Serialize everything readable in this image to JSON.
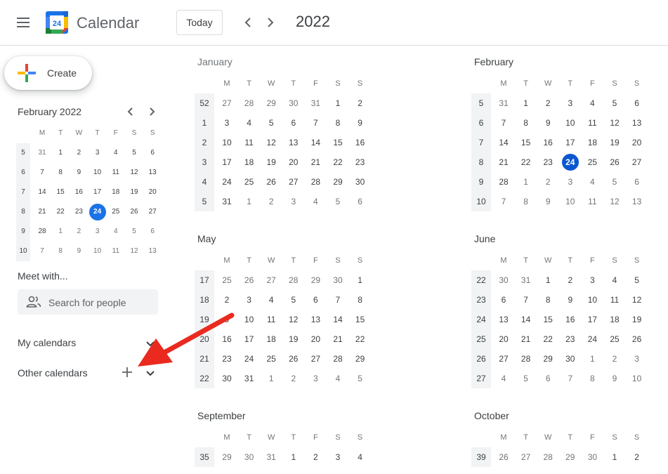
{
  "header": {
    "app_title": "Calendar",
    "logo_number": "24",
    "today_label": "Today",
    "year": "2022"
  },
  "create_label": "Create",
  "mini": {
    "title": "February 2022",
    "day_headers": [
      "M",
      "T",
      "W",
      "T",
      "F",
      "S",
      "S"
    ],
    "rows": [
      {
        "wk": "5",
        "days": [
          "31",
          "1",
          "2",
          "3",
          "4",
          "5",
          "6"
        ],
        "other": [
          0
        ]
      },
      {
        "wk": "6",
        "days": [
          "7",
          "8",
          "9",
          "10",
          "11",
          "12",
          "13"
        ],
        "other": []
      },
      {
        "wk": "7",
        "days": [
          "14",
          "15",
          "16",
          "17",
          "18",
          "19",
          "20"
        ],
        "other": []
      },
      {
        "wk": "8",
        "days": [
          "21",
          "22",
          "23",
          "24",
          "25",
          "26",
          "27"
        ],
        "other": []
      },
      {
        "wk": "9",
        "days": [
          "28",
          "1",
          "2",
          "3",
          "4",
          "5",
          "6"
        ],
        "other": [
          1,
          2,
          3,
          4,
          5,
          6
        ]
      },
      {
        "wk": "10",
        "days": [
          "7",
          "8",
          "9",
          "10",
          "11",
          "12",
          "13"
        ],
        "other": [
          0,
          1,
          2,
          3,
          4,
          5,
          6
        ]
      }
    ],
    "today": {
      "row": 3,
      "col": 3
    }
  },
  "meet": {
    "title": "Meet with...",
    "search_placeholder": "Search for people"
  },
  "sections": {
    "my_calendars": "My calendars",
    "other_calendars": "Other calendars"
  },
  "day_headers": [
    "M",
    "T",
    "W",
    "T",
    "F",
    "S",
    "S"
  ],
  "months": [
    {
      "name": "January",
      "past": true,
      "rows": [
        {
          "wk": "52",
          "days": [
            "27",
            "28",
            "29",
            "30",
            "31",
            "1",
            "2"
          ],
          "other": [
            0,
            1,
            2,
            3,
            4
          ]
        },
        {
          "wk": "1",
          "days": [
            "3",
            "4",
            "5",
            "6",
            "7",
            "8",
            "9"
          ],
          "other": []
        },
        {
          "wk": "2",
          "days": [
            "10",
            "11",
            "12",
            "13",
            "14",
            "15",
            "16"
          ],
          "other": []
        },
        {
          "wk": "3",
          "days": [
            "17",
            "18",
            "19",
            "20",
            "21",
            "22",
            "23"
          ],
          "other": []
        },
        {
          "wk": "4",
          "days": [
            "24",
            "25",
            "26",
            "27",
            "28",
            "29",
            "30"
          ],
          "other": []
        },
        {
          "wk": "5",
          "days": [
            "31",
            "1",
            "2",
            "3",
            "4",
            "5",
            "6"
          ],
          "other": [
            1,
            2,
            3,
            4,
            5,
            6
          ]
        }
      ]
    },
    {
      "name": "February",
      "past": false,
      "rows": [
        {
          "wk": "5",
          "days": [
            "31",
            "1",
            "2",
            "3",
            "4",
            "5",
            "6"
          ],
          "other": [
            0
          ]
        },
        {
          "wk": "6",
          "days": [
            "7",
            "8",
            "9",
            "10",
            "11",
            "12",
            "13"
          ],
          "other": []
        },
        {
          "wk": "7",
          "days": [
            "14",
            "15",
            "16",
            "17",
            "18",
            "19",
            "20"
          ],
          "other": []
        },
        {
          "wk": "8",
          "days": [
            "21",
            "22",
            "23",
            "24",
            "25",
            "26",
            "27"
          ],
          "other": []
        },
        {
          "wk": "9",
          "days": [
            "28",
            "1",
            "2",
            "3",
            "4",
            "5",
            "6"
          ],
          "other": [
            1,
            2,
            3,
            4,
            5,
            6
          ]
        },
        {
          "wk": "10",
          "days": [
            "7",
            "8",
            "9",
            "10",
            "11",
            "12",
            "13"
          ],
          "other": [
            0,
            1,
            2,
            3,
            4,
            5,
            6
          ]
        }
      ],
      "today": {
        "row": 3,
        "col": 3
      }
    },
    {
      "name": "May",
      "past": false,
      "rows": [
        {
          "wk": "17",
          "days": [
            "25",
            "26",
            "27",
            "28",
            "29",
            "30",
            "1"
          ],
          "other": [
            0,
            1,
            2,
            3,
            4,
            5
          ]
        },
        {
          "wk": "18",
          "days": [
            "2",
            "3",
            "4",
            "5",
            "6",
            "7",
            "8"
          ],
          "other": []
        },
        {
          "wk": "19",
          "days": [
            "9",
            "10",
            "11",
            "12",
            "13",
            "14",
            "15"
          ],
          "other": []
        },
        {
          "wk": "20",
          "days": [
            "16",
            "17",
            "18",
            "19",
            "20",
            "21",
            "22"
          ],
          "other": []
        },
        {
          "wk": "21",
          "days": [
            "23",
            "24",
            "25",
            "26",
            "27",
            "28",
            "29"
          ],
          "other": []
        },
        {
          "wk": "22",
          "days": [
            "30",
            "31",
            "1",
            "2",
            "3",
            "4",
            "5"
          ],
          "other": [
            2,
            3,
            4,
            5,
            6
          ]
        }
      ]
    },
    {
      "name": "June",
      "past": false,
      "rows": [
        {
          "wk": "22",
          "days": [
            "30",
            "31",
            "1",
            "2",
            "3",
            "4",
            "5"
          ],
          "other": [
            0,
            1
          ]
        },
        {
          "wk": "23",
          "days": [
            "6",
            "7",
            "8",
            "9",
            "10",
            "11",
            "12"
          ],
          "other": []
        },
        {
          "wk": "24",
          "days": [
            "13",
            "14",
            "15",
            "16",
            "17",
            "18",
            "19"
          ],
          "other": []
        },
        {
          "wk": "25",
          "days": [
            "20",
            "21",
            "22",
            "23",
            "24",
            "25",
            "26"
          ],
          "other": []
        },
        {
          "wk": "26",
          "days": [
            "27",
            "28",
            "29",
            "30",
            "1",
            "2",
            "3"
          ],
          "other": [
            4,
            5,
            6
          ]
        },
        {
          "wk": "27",
          "days": [
            "4",
            "5",
            "6",
            "7",
            "8",
            "9",
            "10"
          ],
          "other": [
            0,
            1,
            2,
            3,
            4,
            5,
            6
          ]
        }
      ]
    },
    {
      "name": "September",
      "past": false,
      "rows": [
        {
          "wk": "35",
          "days": [
            "29",
            "30",
            "31",
            "1",
            "2",
            "3",
            "4"
          ],
          "other": [
            0,
            1,
            2
          ]
        }
      ]
    },
    {
      "name": "October",
      "past": false,
      "rows": [
        {
          "wk": "39",
          "days": [
            "26",
            "27",
            "28",
            "29",
            "30",
            "1",
            "2"
          ],
          "other": [
            0,
            1,
            2,
            3,
            4
          ]
        }
      ]
    }
  ],
  "colors": {
    "accent": "#1a73e8",
    "today_main": "#0b57d0",
    "annotation_arrow": "#ea2a1f"
  }
}
